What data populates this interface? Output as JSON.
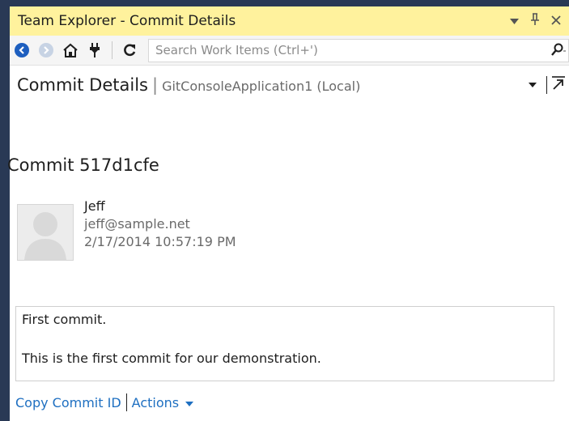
{
  "window": {
    "title": "Team Explorer - Commit Details",
    "dropdown_glyph": "▼",
    "pin_glyph": "ꟷ",
    "close_glyph": "×"
  },
  "toolbar": {
    "search_placeholder": "Search Work Items (Ctrl+')",
    "icons": [
      "back-icon",
      "forward-icon",
      "home-icon",
      "connect-icon",
      "refresh-icon",
      "search-icon"
    ]
  },
  "header": {
    "title": "Commit Details",
    "separator": "|",
    "repository": "GitConsoleApplication1 (Local)"
  },
  "commit": {
    "title": "Commit 517d1cfe",
    "author": "Jeff",
    "email": "jeff@sample.net",
    "date": "2/17/2014 10:57:19 PM",
    "message_line1": "First commit.",
    "message_line2": "This is the first commit for our demonstration."
  },
  "links": {
    "copy_commit_id": "Copy Commit ID",
    "actions": "Actions"
  },
  "colors": {
    "title_bar": "#fff29d",
    "frame": "#293955",
    "link": "#1e6fc1",
    "nav_back": "#1e5fbf"
  }
}
